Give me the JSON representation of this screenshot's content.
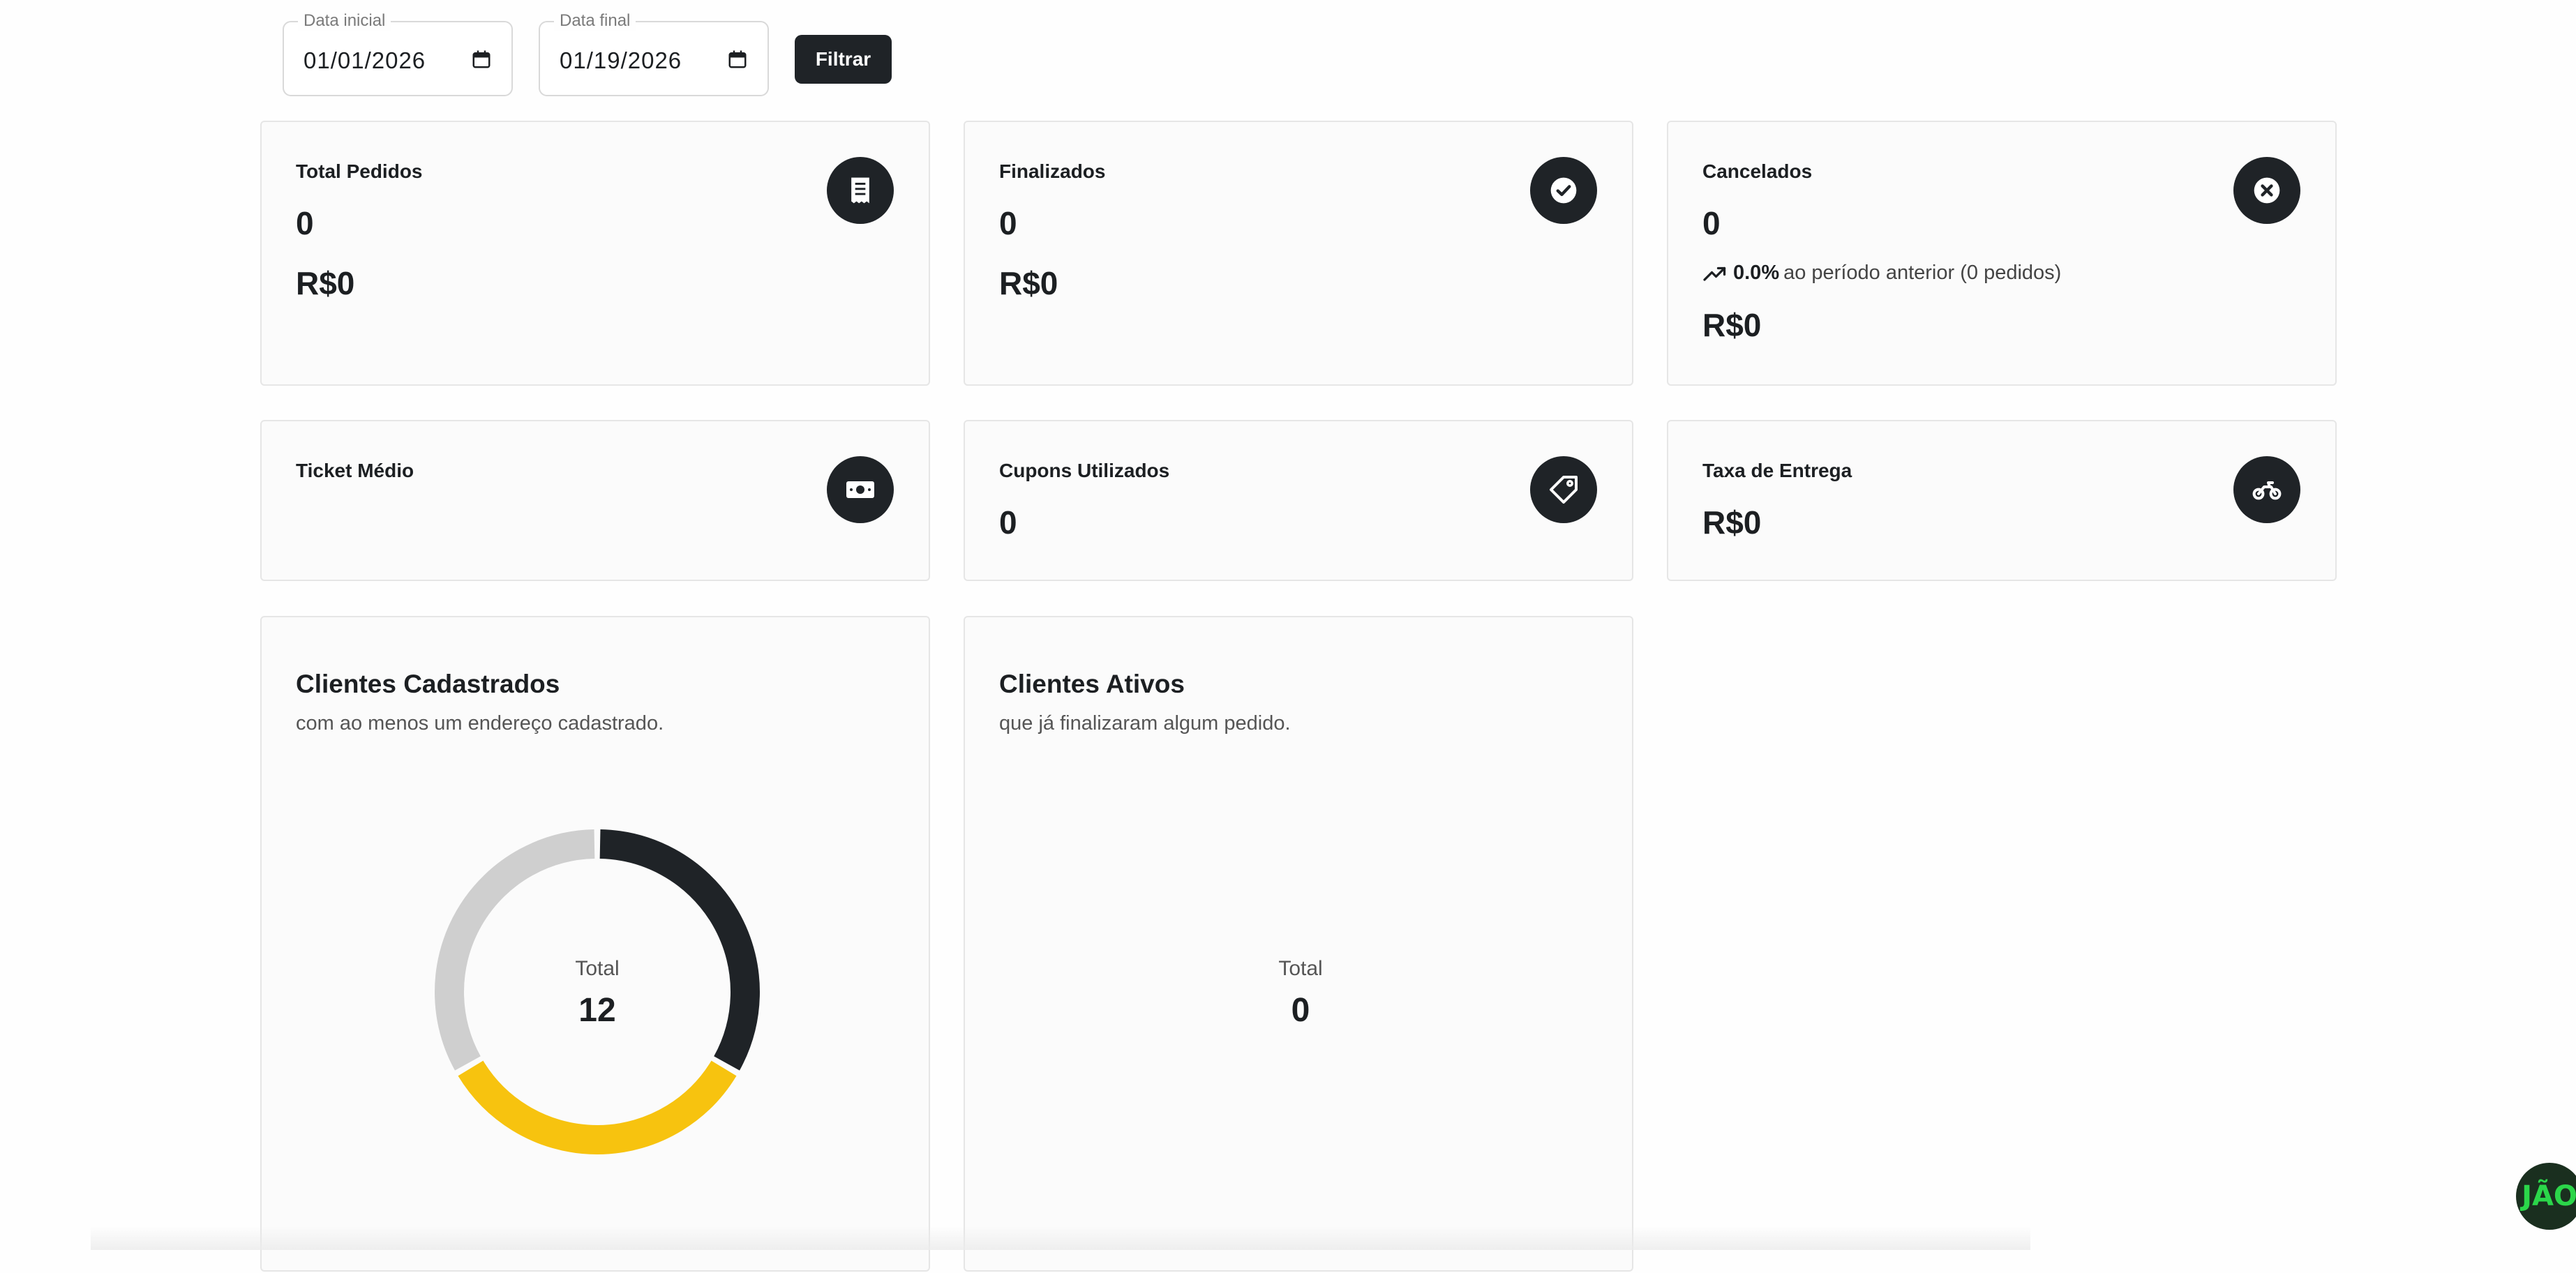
{
  "filters": {
    "start_label": "Data inicial",
    "start_value": "01/01/2026",
    "end_label": "Data final",
    "end_value": "01/19/2026",
    "filter_button": "Filtrar"
  },
  "cards": {
    "total_pedidos": {
      "title": "Total Pedidos",
      "count": "0",
      "amount": "R$0",
      "icon": "receipt-icon"
    },
    "finalizados": {
      "title": "Finalizados",
      "count": "0",
      "amount": "R$0",
      "icon": "check-circle-icon"
    },
    "cancelados": {
      "title": "Cancelados",
      "count": "0",
      "amount": "R$0",
      "icon": "x-circle-icon",
      "trend_value": "0.0%",
      "trend_text": "ao período anterior (0 pedidos)"
    },
    "ticket_medio": {
      "title": "Ticket Médio",
      "icon": "banknote-icon"
    },
    "cupons": {
      "title": "Cupons Utilizados",
      "count": "0",
      "icon": "tag-icon"
    },
    "taxa_entrega": {
      "title": "Taxa de Entrega",
      "amount": "R$0",
      "icon": "motorcycle-icon"
    }
  },
  "clientes_cadastrados": {
    "title": "Clientes Cadastrados",
    "subtitle": "com ao menos um endereço cadastrado.",
    "total_label": "Total",
    "total_value": "12"
  },
  "clientes_ativos": {
    "title": "Clientes Ativos",
    "subtitle": "que já finalizaram algum pedido.",
    "total_label": "Total",
    "total_value": "0"
  },
  "chart_data": {
    "type": "pie",
    "values": [
      4,
      4,
      4
    ],
    "colors": [
      "#1f2327",
      "#f7c30f",
      "#cfcfcf"
    ],
    "total": 12
  },
  "colors": {
    "dark": "#1f2327",
    "yellow": "#f7c30f",
    "gray": "#cfcfcf",
    "brand_green": "#2bd64a"
  },
  "badge": {
    "text": "JÃO"
  }
}
